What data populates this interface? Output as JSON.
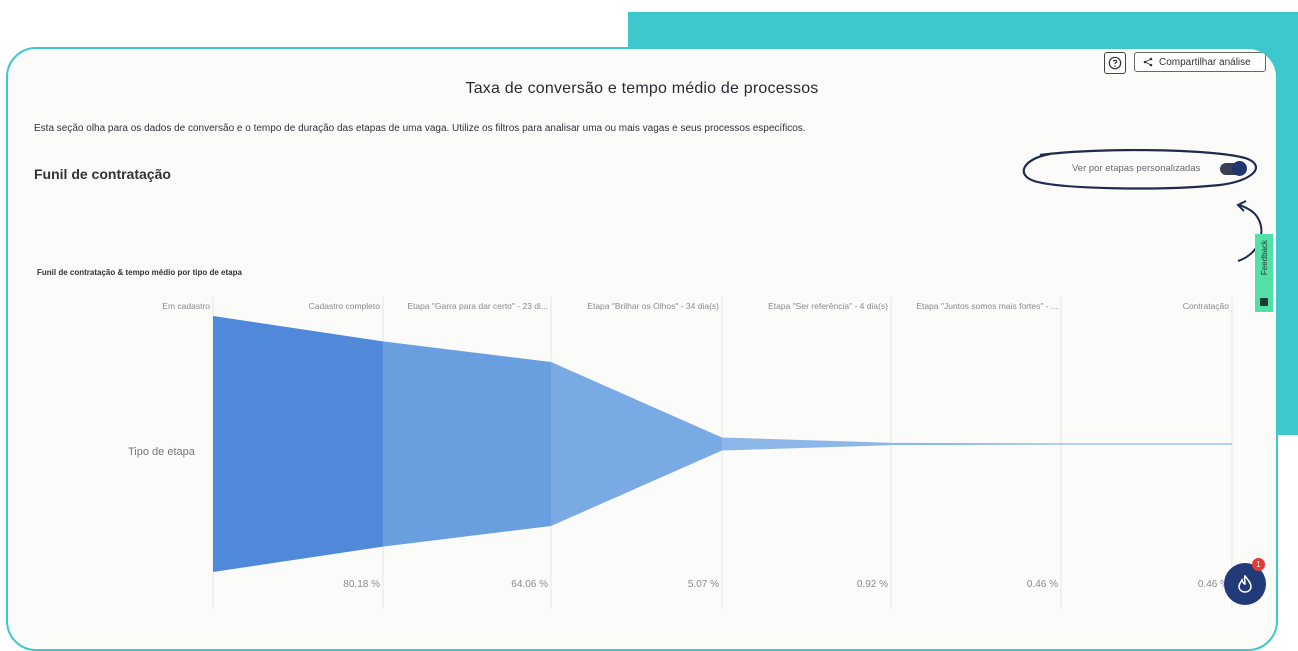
{
  "header": {
    "help_icon": "question-circle-icon",
    "share_label": "Compartilhar análise",
    "share_icon": "share-icon"
  },
  "page": {
    "title": "Taxa de conversão e tempo médio de processos",
    "description": "Esta seção olha para os dados de conversão e o tempo de duração das etapas de uma vaga. Utilize os filtros para analisar uma ou mais vagas e seus processos específicos."
  },
  "funnel_section": {
    "title": "Funil de contratação",
    "toggle_label": "Ver por etapas personalizadas",
    "toggle_on": true
  },
  "feedback": {
    "label": "Feedback"
  },
  "chat": {
    "badge": "1"
  },
  "colors": {
    "teal": "#3dc8cb",
    "funnel_1": "#5089d9",
    "funnel_2": "#6a9fdf",
    "funnel_3": "#7aaae3",
    "funnel_4": "#8cb7e8",
    "toggle": "#1f3670",
    "feedback": "#53e0a6"
  },
  "chart_data": {
    "type": "funnel",
    "title": "Funil de contratação & tempo médio por tipo de etapa",
    "row_label": "Tipo de etapa",
    "stages": [
      "Em cadastro",
      "Cadastro completo",
      "Etapa \"Garra para dar certo\" - 23 di...",
      "Etapa \"Brilhar os Olhos\" - 34 dia(s)",
      "Etapa \"Ser referência\" - 4 dia(s)",
      "Etapa \"Juntos somos mais fortes\" - ...",
      "Contratação"
    ],
    "values_percent": [
      100,
      80.18,
      64.06,
      5.07,
      0.92,
      0.46,
      0.46
    ],
    "percent_labels": [
      "80.18 %",
      "64.06 %",
      "5.07 %",
      "0.92 %",
      "0.46 %",
      "0.46 %"
    ]
  }
}
